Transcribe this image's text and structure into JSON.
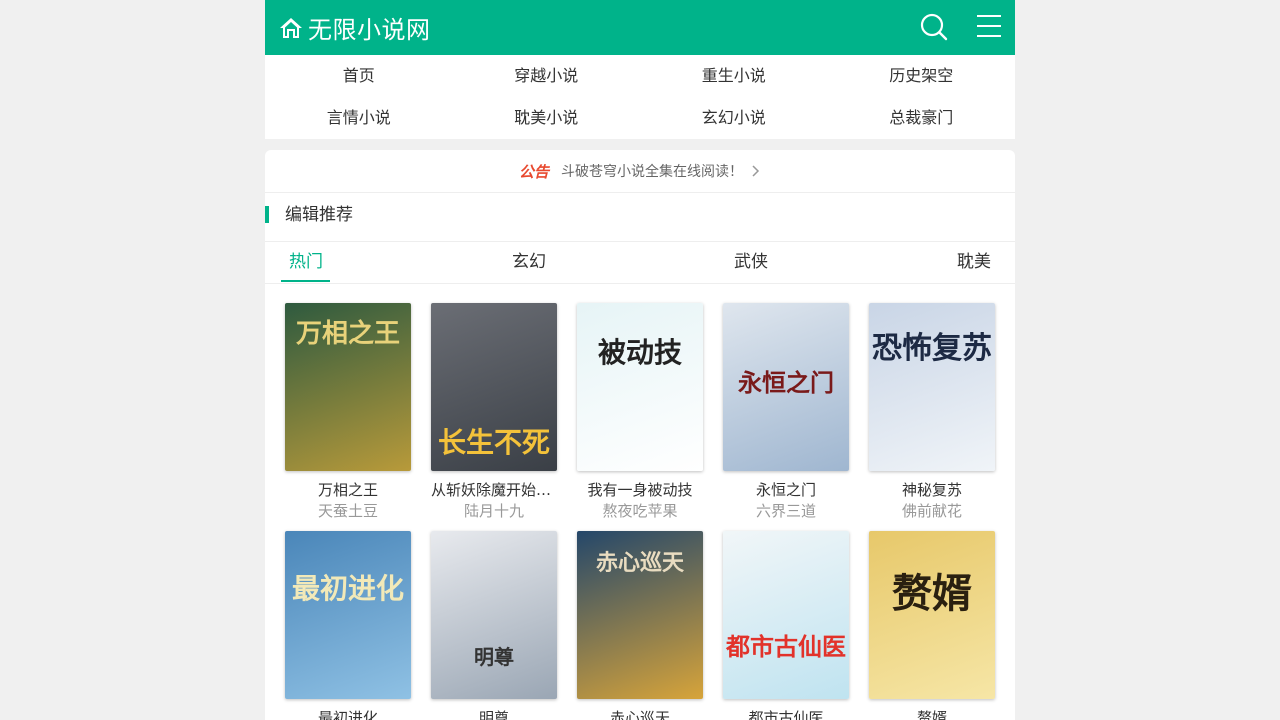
{
  "header": {
    "site_title": "无限小说网"
  },
  "nav": {
    "items": [
      {
        "label": "首页"
      },
      {
        "label": "穿越小说"
      },
      {
        "label": "重生小说"
      },
      {
        "label": "历史架空"
      },
      {
        "label": "言情小说"
      },
      {
        "label": "耽美小说"
      },
      {
        "label": "玄幻小说"
      },
      {
        "label": "总裁豪门"
      }
    ]
  },
  "notice": {
    "tag": "公告",
    "text": "斗破苍穹小说全集在线阅读！"
  },
  "section": {
    "title": "编辑推荐",
    "tabs": [
      {
        "label": "热门"
      },
      {
        "label": "玄幻"
      },
      {
        "label": "武侠"
      },
      {
        "label": "耽美"
      }
    ],
    "active_tab": "热门"
  },
  "books": [
    {
      "title": "万相之王",
      "author": "天蚕土豆",
      "cover_text": "万相之王",
      "cover_color": "#2e5a3f"
    },
    {
      "title": "从斩妖除魔开始长生不死",
      "author": "陆月十九",
      "cover_text": "长生不死",
      "cover_color": "#6b6e75"
    },
    {
      "title": "我有一身被动技",
      "author": "熬夜吃苹果",
      "cover_text": "被动技",
      "cover_color": "#e6f4f6"
    },
    {
      "title": "永恒之门",
      "author": "六界三道",
      "cover_text": "永恒之门",
      "cover_color": "#dfe6ee"
    },
    {
      "title": "神秘复苏",
      "author": "佛前献花",
      "cover_text": "恐怖复苏",
      "cover_color": "#c9d5e6"
    },
    {
      "title": "最初进化",
      "author": "",
      "cover_text": "最初进化",
      "cover_color": "#4a86b9"
    },
    {
      "title": "明尊",
      "author": "",
      "cover_text": "明尊",
      "cover_color": "#e8eaee"
    },
    {
      "title": "赤心巡天",
      "author": "",
      "cover_text": "赤心巡天",
      "cover_color": "#24476a"
    },
    {
      "title": "都市古仙医",
      "author": "",
      "cover_text": "都市古仙医",
      "cover_color": "#f1f6f8"
    },
    {
      "title": "赘婿",
      "author": "",
      "cover_text": "赘婿",
      "cover_color": "#e7c86a"
    }
  ],
  "colors": {
    "brand": "#00b38a",
    "notice_tag": "#e8492f"
  }
}
